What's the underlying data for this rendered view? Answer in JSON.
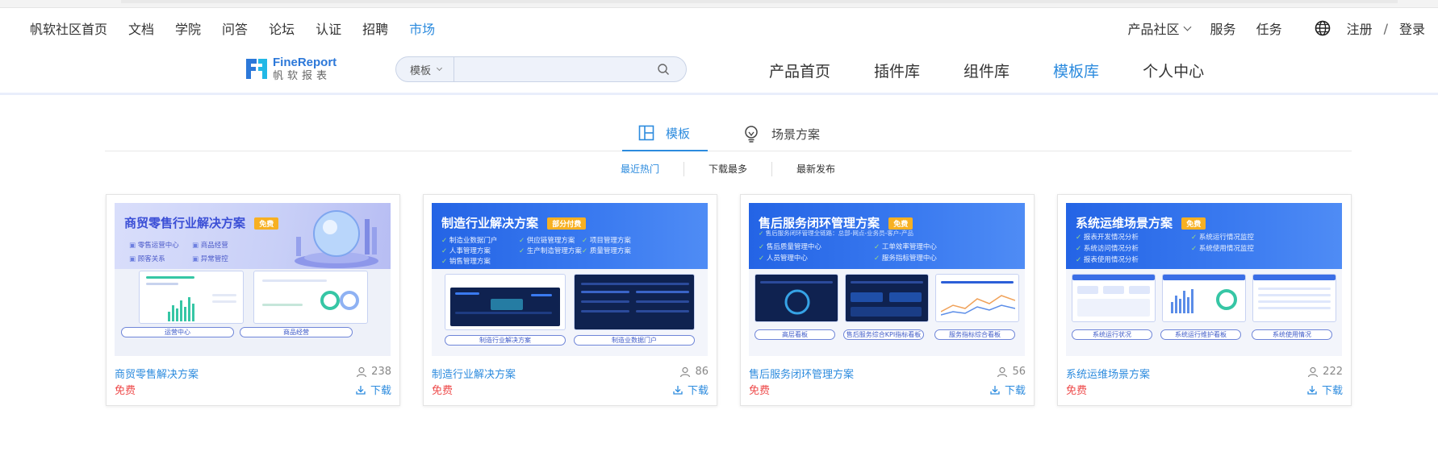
{
  "global_nav": {
    "items": [
      "帆软社区首页",
      "文档",
      "学院",
      "问答",
      "论坛",
      "认证",
      "招聘",
      "市场"
    ],
    "active": "市场",
    "right": {
      "product_community": "产品社区",
      "service": "服务",
      "tasks": "任务",
      "register": "注册",
      "separator": "/",
      "login": "登录"
    }
  },
  "header": {
    "logo_en": "FineReport",
    "logo_cn": "帆软报表",
    "search": {
      "type": "模板",
      "placeholder": ""
    },
    "nav": [
      "产品首页",
      "插件库",
      "组件库",
      "模板库",
      "个人中心"
    ],
    "active_nav": "模板库"
  },
  "tabs": {
    "template": "模板",
    "scenario": "场景方案"
  },
  "filters": [
    "最近热门",
    "下载最多",
    "最新发布"
  ],
  "colors": {
    "accent": "#2c8bde",
    "free": "#ee4a4a",
    "banner_blue": "#2464e5"
  },
  "cards": [
    {
      "title": "商贸零售解决方案",
      "count": "238",
      "price": "免费",
      "download": "下载",
      "thumb": {
        "banner_title": "商贸零售行业解决方案",
        "tag": "免费",
        "bullets": [
          "零售运营中心",
          "商品经营",
          "顾客关系",
          "异常管控"
        ],
        "captions": [
          "运营中心",
          "商品经营"
        ]
      }
    },
    {
      "title": "制造行业解决方案",
      "count": "86",
      "price": "免费",
      "download": "下载",
      "thumb": {
        "banner_title": "制造行业解决方案",
        "tag": "部分付费",
        "bullets": [
          "制造业数据门户",
          "供应链管理方案",
          "项目管理方案",
          "人事管理方案",
          "生产制造管理方案",
          "质量管理方案",
          "销售管理方案"
        ],
        "captions": [
          "制造行业解决方案",
          "制造业数据门户"
        ]
      }
    },
    {
      "title": "售后服务闭环管理方案",
      "count": "56",
      "price": "免费",
      "download": "下载",
      "thumb": {
        "banner_title": "售后服务闭环管理方案",
        "tag": "免费",
        "subtitle": "售后服务闭环管理全链路：总部-网点-业务员-客户-产品",
        "bullets": [
          "售后质量管理中心",
          "工单效率管理中心",
          "人员管理中心",
          "服务指标管理中心"
        ],
        "captions": [
          "高层看板",
          "售后服务综合KPI指标看板",
          "服务指标综合看板"
        ]
      }
    },
    {
      "title": "系统运维场景方案",
      "count": "222",
      "price": "免费",
      "download": "下载",
      "thumb": {
        "banner_title": "系统运维场景方案",
        "tag": "免费",
        "bullets": [
          "报表开发情况分析",
          "系统运行情况监控",
          "系统访问情况分析",
          "系统使用情况监控",
          "报表使用情况分析"
        ],
        "captions": [
          "系统运行状况",
          "系统运行维护看板",
          "系统使用情况"
        ]
      }
    }
  ]
}
